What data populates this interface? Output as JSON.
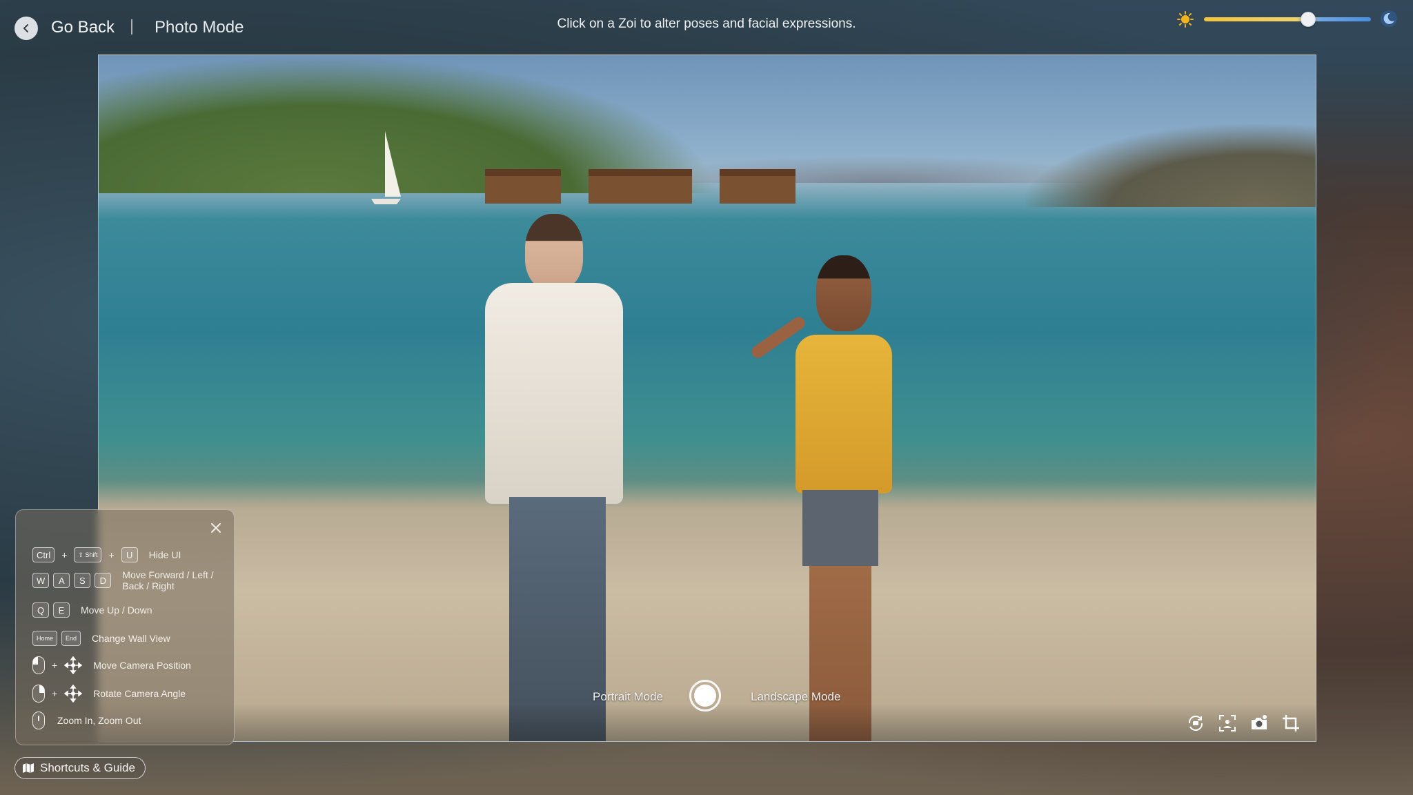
{
  "topbar": {
    "back_label": "Go Back",
    "mode_label": "Photo Mode",
    "hint": "Click on a Zoi to alter poses and facial expressions.",
    "time_of_day_level": 0.62
  },
  "capture": {
    "portrait_label": "Portrait Mode",
    "landscape_label": "Landscape Mode"
  },
  "tools": [
    "rotate-camera-icon",
    "focus-frame-icon",
    "camera-settings-icon",
    "crop-icon"
  ],
  "shortcuts": {
    "rows": [
      {
        "keys": [
          "Ctrl",
          "⇧ Shift",
          "U"
        ],
        "text": "Hide UI"
      },
      {
        "keys": [
          "W",
          "A",
          "S",
          "D"
        ],
        "text": "Move Forward / Left / Back / Right"
      },
      {
        "keys": [
          "Q",
          "E"
        ],
        "text": "Move Up / Down"
      },
      {
        "keys": [
          "Home",
          "End"
        ],
        "text": "Change Wall View"
      },
      {
        "text": "Move Camera Position"
      },
      {
        "text": "Rotate Camera Angle"
      },
      {
        "text": "Zoom In, Zoom Out"
      }
    ]
  },
  "guide_label": "Shortcuts & Guide",
  "colors": {
    "sun": "#f6b41c",
    "moon": "#4a8fe0"
  }
}
